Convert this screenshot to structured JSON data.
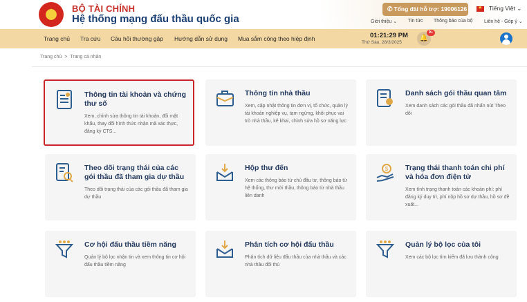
{
  "header": {
    "org": "BỘ TÀI CHÍNH",
    "site_name": "Hệ thống mạng đấu thầu quốc gia",
    "hotline": "Tổng đài hỗ trợ: 19006126",
    "language": "Tiếng Việt",
    "top_links": [
      "Giới thiệu",
      "Tin tức",
      "Thông báo của bộ",
      "Liên hệ - Góp ý"
    ]
  },
  "nav": {
    "items": [
      "Trang chủ",
      "Tra cứu",
      "Câu hỏi thường gặp",
      "Hướng dẫn sử dụng",
      "Mua sắm công theo hiệp định"
    ],
    "time": "01:21:29 PM",
    "date": "Thứ Sáu, 28/3/2025",
    "notification_count": "9+"
  },
  "breadcrumb": [
    "Trang chủ",
    "Trang cá nhân"
  ],
  "colors": {
    "accent": "#c99a5e",
    "nav_bg": "#f4d8a3",
    "title": "#243a5e",
    "icon": "#2e5d8f",
    "selected_border": "#c9252b"
  },
  "cards": [
    {
      "icon": "account-document-icon",
      "title": "Thông tin tài khoản và chứng thư số",
      "desc": "Xem, chỉnh sửa thông tin tài khoản, đổi mật khẩu, thay đổi hình thức nhận mã xác thực, đăng ký CTS...",
      "selected": true
    },
    {
      "icon": "briefcase-icon",
      "title": "Thông tin nhà thầu",
      "desc": "Xem, cập nhật thông tin đơn vị, tổ chức, quản lý tài khoản nghiệp vụ, tạm ngừng, khôi phục vai trò nhà thầu, kê khai, chỉnh sửa hồ sơ năng lực"
    },
    {
      "icon": "certificate-icon",
      "title": "Danh sách gói thầu quan tâm",
      "desc": "Xem danh sách các gói thầu đã nhấn nút Theo dõi"
    },
    {
      "icon": "document-search-icon",
      "title": "Theo dõi trạng thái của các gói thầu đã tham gia dự thầu",
      "desc": "Theo dõi trạng thái của các gói thầu đã tham gia dự thầu"
    },
    {
      "icon": "inbox-download-icon",
      "title": "Hộp thư đến",
      "desc": "Xem các thông báo từ chủ đầu tư, thông báo từ hệ thống, thư mời thầu, thông báo từ nhà thầu liên danh"
    },
    {
      "icon": "payment-hand-icon",
      "title": "Trạng thái thanh toán chi phí và hóa đơn điện tử",
      "desc": "Xem tình trạng thanh toán các khoản phí: phí đăng ký duy trì, phí nộp hồ sơ dự thầu, hồ sơ đề xuất..."
    },
    {
      "icon": "filter-icon",
      "title": "Cơ hội đấu thầu tiềm năng",
      "desc": "Quản lý bộ lọc nhận tin và xem thông tin cơ hội đấu thầu tiềm năng"
    },
    {
      "icon": "inbox-download-icon",
      "title": "Phân tích cơ hội đấu thầu",
      "desc": "Phân tích dữ liệu đấu thầu của nhà thầu và các nhà thầu đối thủ"
    },
    {
      "icon": "filter-icon",
      "title": "Quản lý bộ lọc của tôi",
      "desc": "Xem các bộ lọc tìm kiếm đã lưu thành công"
    }
  ]
}
